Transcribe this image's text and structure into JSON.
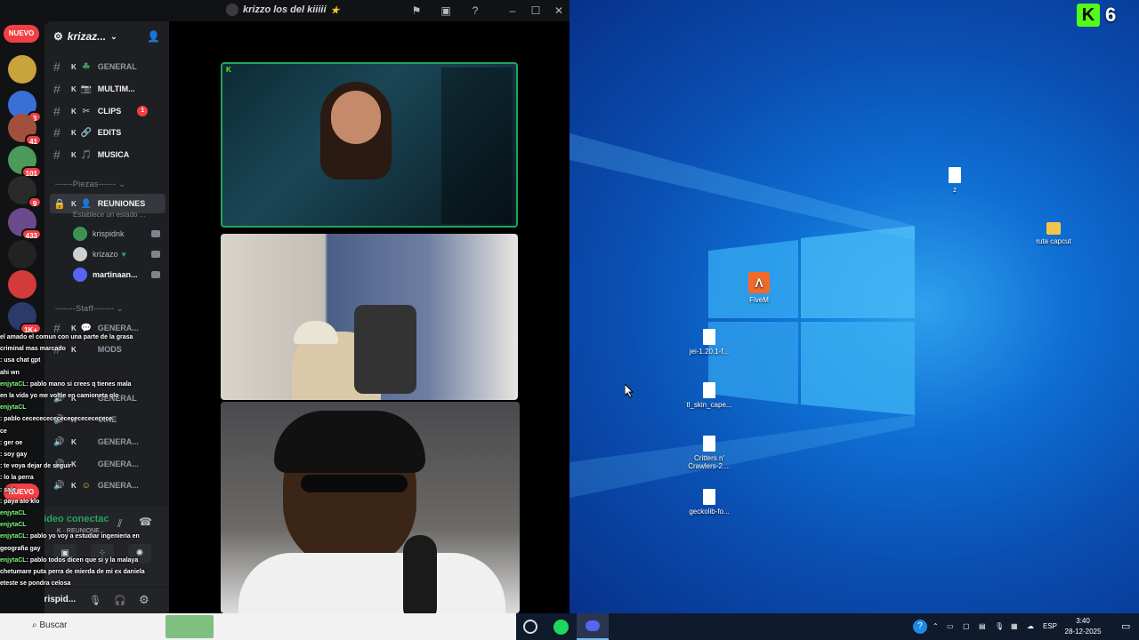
{
  "window": {
    "title": "krizzo los del kiiiii"
  },
  "rail": {
    "nuevo_top": "NUEVO",
    "nuevo_bottom": "NUEVO",
    "badges": [
      "3",
      "41",
      "101",
      "9",
      "433",
      "1K+"
    ]
  },
  "server": {
    "name": "krizaz..."
  },
  "channels": [
    {
      "prefix": "K",
      "label": "GENERAL",
      "emoji": "☘"
    },
    {
      "prefix": "K",
      "label": "MULTIM...",
      "emoji": "📷"
    },
    {
      "prefix": "K",
      "label": "CLIPS",
      "emoji": "✂",
      "badge": "1"
    },
    {
      "prefix": "K",
      "label": "EDITS",
      "emoji": "🔗"
    },
    {
      "prefix": "K",
      "label": "MUSICA",
      "emoji": "🎵"
    }
  ],
  "categories": {
    "piezas": "------Piezas------",
    "staff": "-------Staff-------"
  },
  "reuniones": {
    "label": "REUNIONES",
    "status": "Establece un estado ...",
    "members": [
      {
        "name": "krispidnk"
      },
      {
        "name": "krizazo"
      },
      {
        "name": "martinaan..."
      }
    ]
  },
  "staff_channels": [
    {
      "prefix": "K",
      "label": "GENERA..."
    },
    {
      "prefix": "K",
      "label": "MODS"
    },
    {
      "prefix": "K",
      "label": "GENERAL"
    },
    {
      "prefix": "K",
      "label": "CINE"
    },
    {
      "prefix": "K",
      "label": "GENERA..."
    },
    {
      "prefix": "K",
      "label": "GENERA..."
    },
    {
      "prefix": "K",
      "label": "GENERA..."
    }
  ],
  "voice_panel": {
    "status": "Video conectac",
    "channel": "REUNIONE..."
  },
  "user_panel": {
    "name": "krispid..."
  },
  "chat_overlay": [
    {
      "who": "",
      "text": "el amado el comun con una parte de la grasa"
    },
    {
      "who": "",
      "text": "criminal mas marcado"
    },
    {
      "who": "",
      "text": ": usa chat gpt"
    },
    {
      "who": "",
      "text": "ahi wn"
    },
    {
      "who": "enjytaCL",
      "text": ": pablo mano si crees q tienes mala"
    },
    {
      "who": "",
      "text": "en la vida yo me voltie en camioneta qlo"
    },
    {
      "who": "enjytaCL",
      "text": ""
    },
    {
      "who": "",
      "text": ": pablo cecececececececececececece"
    },
    {
      "who": "",
      "text": "ce"
    },
    {
      "who": "",
      "text": ": ger oe"
    },
    {
      "who": "",
      "text": ": soy gay"
    },
    {
      "who": "",
      "text": ": te voya dejar de seguir"
    },
    {
      "who": "",
      "text": ": lo la perra"
    },
    {
      "who": "",
      "text": ": sale"
    },
    {
      "who": "",
      "text": ": paya alo klo"
    },
    {
      "who": "enjytaCL",
      "text": ""
    },
    {
      "who": "enjytaCL",
      "text": ""
    },
    {
      "who": "enjytaCL",
      "text": ": pablo yo voy a estudiar ingenieria en"
    },
    {
      "who": "",
      "text": "geografia gay"
    },
    {
      "who": "enjytaCL",
      "text": ": pablo todos dicen que si y la malaya"
    },
    {
      "who": "",
      "text": "chetumare puta perra de mierda de mi ex daniela"
    },
    {
      "who": "",
      "text": "eteste se pondra celosa"
    }
  ],
  "search": {
    "placeholder": "Buscar"
  },
  "desktop": {
    "icons": [
      {
        "label": "z",
        "kind": "file"
      },
      {
        "label": "ruta capcut",
        "kind": "folder"
      },
      {
        "label": "FiveM",
        "kind": "app"
      },
      {
        "label": "jei-1.20.1-f...",
        "kind": "file"
      },
      {
        "label": "tl_skin_cape...",
        "kind": "file"
      },
      {
        "label": "Critters n' Crawlers-2....",
        "kind": "file"
      },
      {
        "label": "geckolib-fo...",
        "kind": "file"
      }
    ]
  },
  "kick_badge": {
    "letter": "K",
    "count": "6"
  },
  "taskbar": {
    "lang": "ESP",
    "time": "3:40",
    "date": "28-12-2025"
  },
  "colors": {
    "discord_bg": "#1e1f22",
    "rail_bg": "#111214",
    "badge_red": "#f23f43",
    "green": "#23a55a",
    "kick_green": "#53fc18",
    "desktop_blue": "#0f6fd3"
  }
}
